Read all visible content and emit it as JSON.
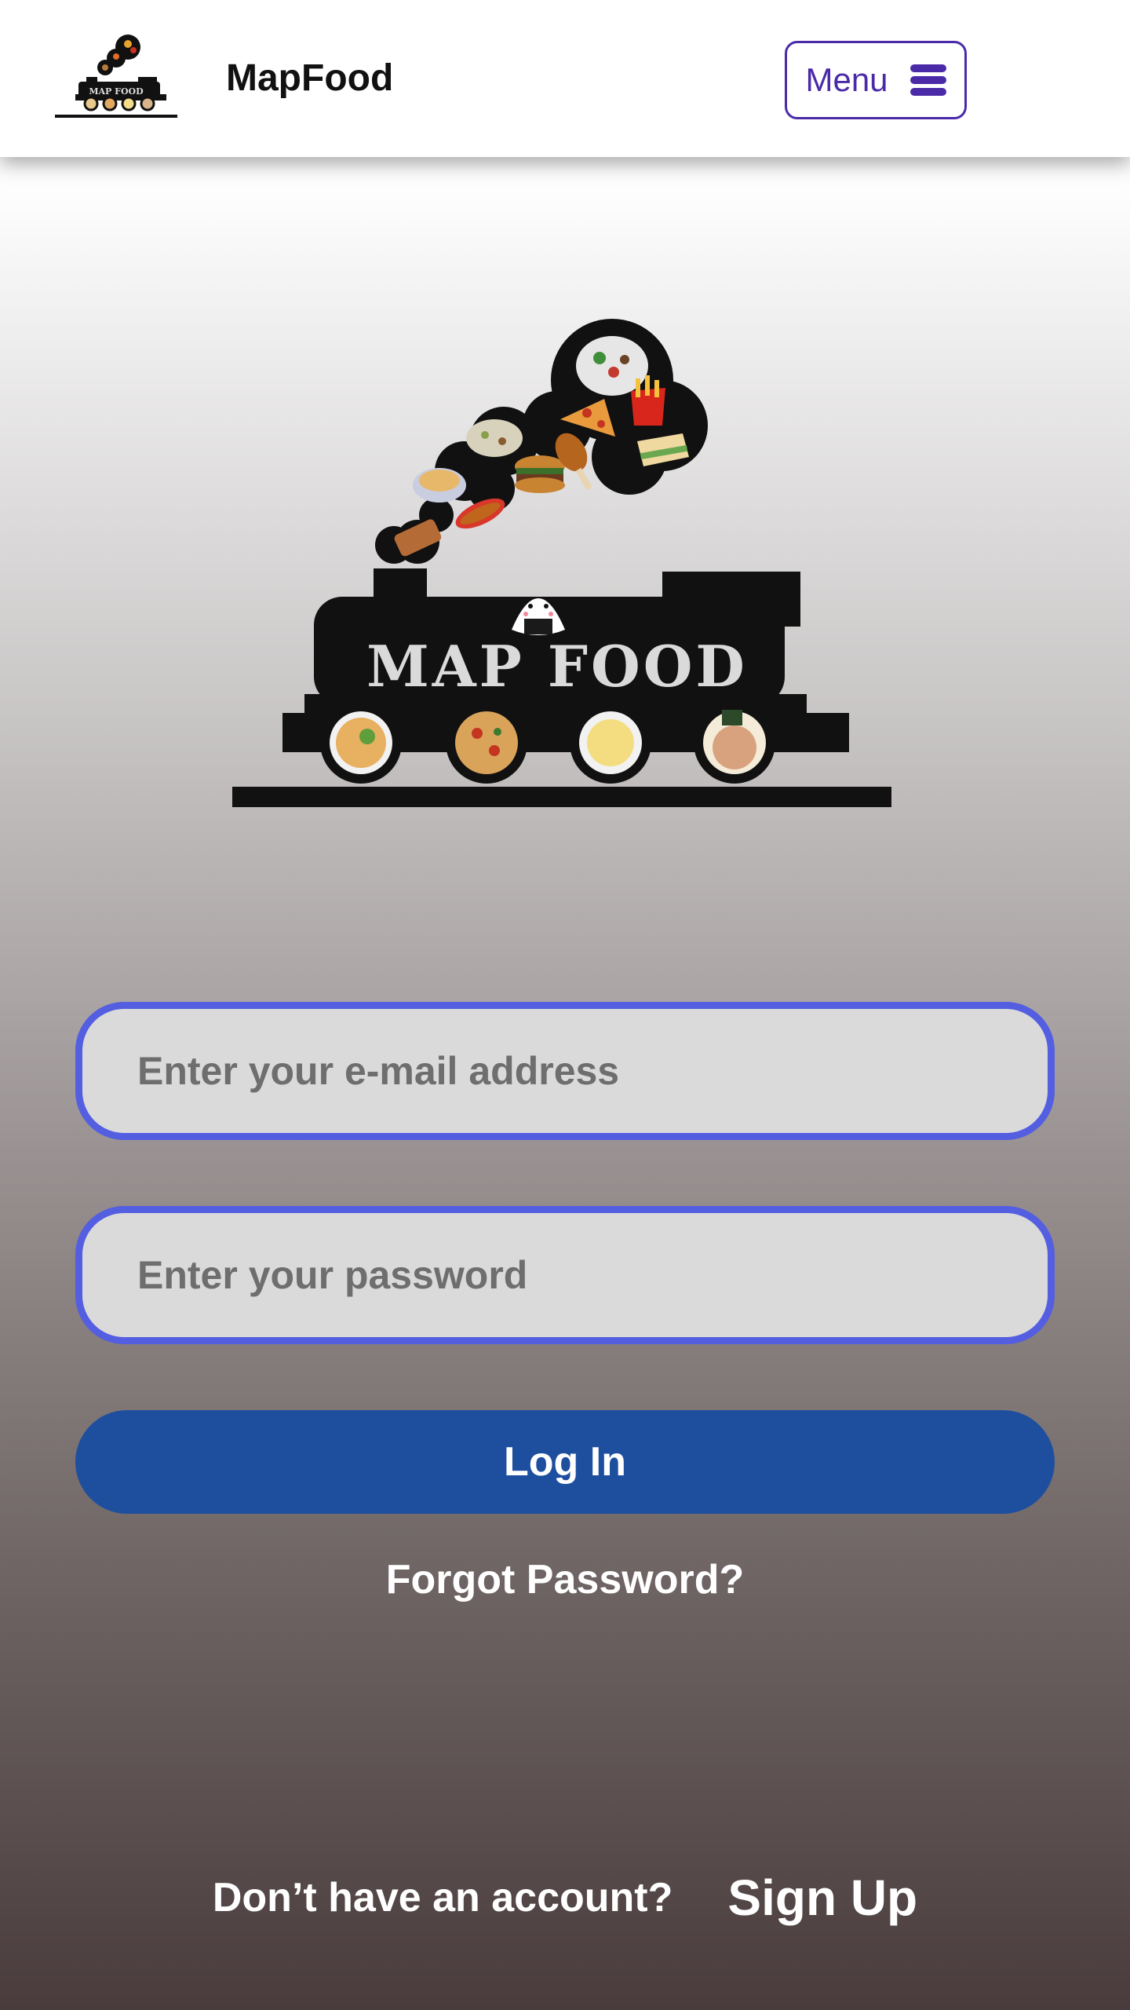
{
  "header": {
    "app_title": "MapFood",
    "logo_text": "MAP FOOD",
    "menu_label": "Menu",
    "menu_icon": "hamburger-icon"
  },
  "hero": {
    "logo_text": "MAP FOOD",
    "logo_icon": "food-train-logo"
  },
  "form": {
    "email_placeholder": "Enter your e-mail address",
    "email_value": "",
    "password_placeholder": "Enter your password",
    "password_value": "",
    "login_label": "Log In",
    "forgot_label": "Forgot Password?"
  },
  "footer": {
    "no_account_text": "Don’t have an account?",
    "signup_label": "Sign Up"
  },
  "colors": {
    "accent": "#4b2aa8",
    "field_border": "#545ee0",
    "button": "#1d4f9e",
    "field_bg": "#dadadb"
  }
}
